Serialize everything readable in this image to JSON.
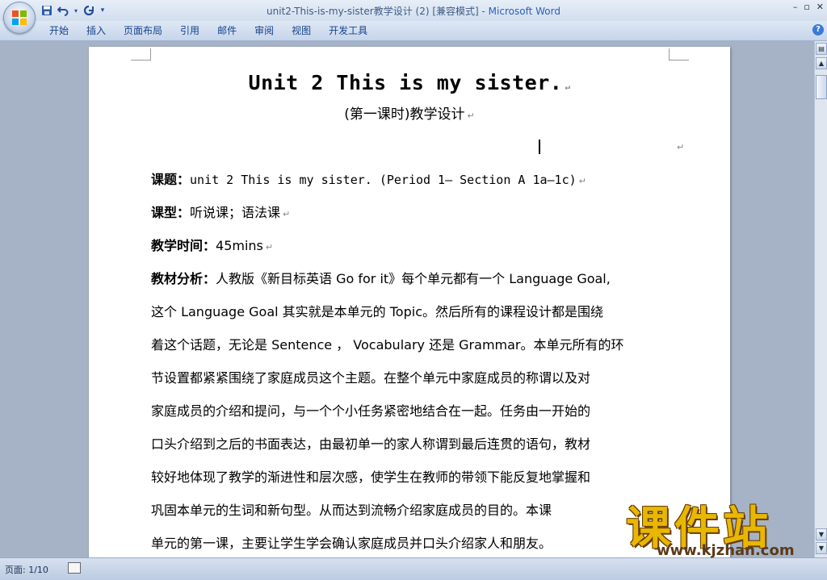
{
  "window": {
    "title_doc": "unit2-This-is-my-sister教学设计 (2) [兼容模式]",
    "title_sep": " - ",
    "title_app": "Microsoft Word",
    "controls": {
      "minimize": "–",
      "restore": "▫",
      "close": "✕"
    }
  },
  "qat": {
    "save_icon": "floppy-disk",
    "undo_icon": "undo-arrow",
    "redo_icon": "redo-arrow",
    "customize": "▾"
  },
  "ribbon": {
    "tabs": [
      "开始",
      "插入",
      "页面布局",
      "引用",
      "邮件",
      "审阅",
      "视图",
      "开发工具"
    ],
    "help": "?"
  },
  "document": {
    "title": "Unit 2 This is my sister.",
    "subtitle": "(第一课时)教学设计",
    "para_mark": "↵",
    "lines": [
      {
        "label": "课题：",
        "text": "unit 2 This is my sister. (Period 1— Section A 1a—1c)"
      },
      {
        "label": "课型：",
        "text": "听说课；语法课"
      },
      {
        "label": "教学时间：",
        "text": "45mins"
      },
      {
        "label": "教材分析：",
        "text": "人教版《新目标英语 Go for it》每个单元都有一个 Language Goal,"
      },
      {
        "label": "",
        "text": "这个 Language Goal 其实就是本单元的 Topic。然后所有的课程设计都是围绕"
      },
      {
        "label": "",
        "text": "着这个话题，无论是 Sentence ， Vocabulary 还是 Grammar。本单元所有的环"
      },
      {
        "label": "",
        "text": "节设置都紧紧围绕了家庭成员这个主题。在整个单元中家庭成员的称谓以及对"
      },
      {
        "label": "",
        "text": "家庭成员的介绍和提问，与一个个小任务紧密地结合在一起。任务由一开始的"
      },
      {
        "label": "",
        "text": "口头介绍到之后的书面表达，由最初单一的家人称谓到最后连贯的语句，教材"
      },
      {
        "label": "",
        "text": "较好地体现了教学的渐进性和层次感，使学生在教师的带领下能反复地掌握和"
      },
      {
        "label": "",
        "text": "巩固本单元的生词和新句型。从而达到流畅介绍家庭成员的目的。本课"
      },
      {
        "label": "",
        "text": "单元的第一课，主要让学生学会确认家庭成员并口头介绍家人和朋友。"
      }
    ]
  },
  "statusbar": {
    "page": "页面: 1/10"
  },
  "watermark": {
    "title": "课件站",
    "url": "www.kjzhan.com"
  }
}
